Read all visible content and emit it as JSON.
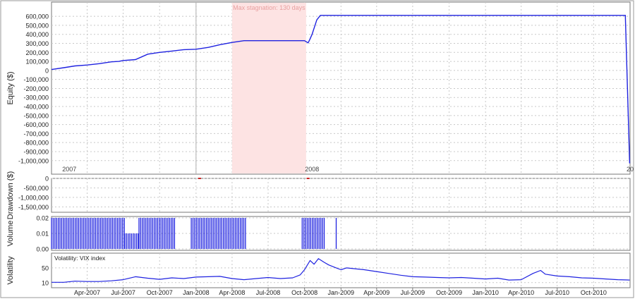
{
  "colors": {
    "series": "#1f22e0",
    "stagnation_fill": "#fde3e3",
    "stagnation_label": "#e8a0a0",
    "grid": "#c8c8c8",
    "axis": "#777777",
    "marker": "#cc2222"
  },
  "chart_data": [
    {
      "type": "line",
      "panel": "equity",
      "ylabel": "Equity ($)",
      "ylim": [
        -1080000,
        640000
      ],
      "yticks": [
        600000,
        500000,
        400000,
        300000,
        200000,
        100000,
        0,
        -100000,
        -200000,
        -300000,
        -400000,
        -500000,
        -600000,
        -700000,
        -800000,
        -900000,
        -1000000
      ],
      "ytick_labels": [
        "600,000",
        "500,000",
        "400,000",
        "300,000",
        "200,000",
        "100,000",
        "0",
        "-100,000",
        "-200,000",
        "-300,000",
        "-400,000",
        "-500,000",
        "-600,000",
        "-700,000",
        "-800,000",
        "-900,000",
        "-1,000,000"
      ],
      "year_labels": [
        {
          "x": "2007-02-15",
          "text": "2007"
        },
        {
          "x": "2008-10-20",
          "text": "2008"
        },
        {
          "x": "2011-01-01",
          "text": "20"
        }
      ],
      "annotation": {
        "text": "Max stagnation: 130 days",
        "start": "2008-04-01",
        "end": "2008-10-05"
      },
      "x": [
        "2007-01-01",
        "2007-02-01",
        "2007-03-01",
        "2007-04-01",
        "2007-05-01",
        "2007-06-01",
        "2007-06-20",
        "2007-07-01",
        "2007-08-01",
        "2007-09-01",
        "2007-10-01",
        "2007-11-01",
        "2007-12-01",
        "2008-01-01",
        "2008-02-01",
        "2008-03-01",
        "2008-04-01",
        "2008-05-01",
        "2008-07-01",
        "2008-09-01",
        "2008-10-01",
        "2008-10-10",
        "2008-10-14",
        "2008-10-20",
        "2008-11-01",
        "2008-11-10",
        "2008-12-01",
        "2009-06-01",
        "2010-01-01",
        "2010-07-01",
        "2010-12-20",
        "2010-12-31"
      ],
      "series": [
        {
          "values": [
            10000,
            30000,
            50000,
            60000,
            75000,
            95000,
            100000,
            110000,
            120000,
            180000,
            200000,
            215000,
            230000,
            235000,
            255000,
            285000,
            310000,
            330000,
            330000,
            330000,
            330000,
            305000,
            340000,
            400000,
            560000,
            610000,
            610000,
            610000,
            610000,
            610000,
            610000,
            -1030000
          ]
        }
      ]
    },
    {
      "type": "line",
      "panel": "drawdown",
      "ylabel": "Drawdown ($)",
      "ylim": [
        -1600000,
        0
      ],
      "yticks": [
        0,
        -500000,
        -1000000,
        -1500000
      ],
      "ytick_labels": [
        "0",
        "-500,000",
        "-1,000,000",
        "-1,500,000"
      ],
      "markers": [
        {
          "x": "2008-01-10",
          "y": 0
        },
        {
          "x": "2008-10-10",
          "y": 0
        }
      ]
    },
    {
      "type": "bar",
      "panel": "volume",
      "ylabel": "Volume",
      "ylim": [
        0,
        0.02
      ],
      "yticks": [
        0.02,
        0.01,
        0.0
      ],
      "ytick_labels": [
        "0.02",
        "0.01",
        "0.00"
      ],
      "bar_periods": [
        {
          "start": "2007-01-01",
          "end": "2007-07-05",
          "value": 0.02
        },
        {
          "start": "2007-07-05",
          "end": "2007-08-10",
          "value": 0.01
        },
        {
          "start": "2007-08-10",
          "end": "2007-11-10",
          "value": 0.02
        },
        {
          "start": "2007-12-20",
          "end": "2008-05-05",
          "value": 0.02
        },
        {
          "start": "2008-09-25",
          "end": "2008-11-20",
          "value": 0.02
        },
        {
          "start": "2008-12-20",
          "end": "2008-12-24",
          "value": 0.02
        }
      ]
    },
    {
      "type": "line",
      "panel": "volatility",
      "ylabel": "Volatility",
      "legend": "Volatility: VIX index",
      "ylim": [
        0,
        90
      ],
      "yticks": [
        50,
        10
      ],
      "ytick_labels": [
        "50",
        "10"
      ],
      "x_tick_labels": [
        {
          "x": "2007-04-01",
          "text": "Apr-2007"
        },
        {
          "x": "2007-07-01",
          "text": "Jul-2007"
        },
        {
          "x": "2007-10-01",
          "text": "Oct-2007"
        },
        {
          "x": "2008-01-01",
          "text": "Jan-2008"
        },
        {
          "x": "2008-04-01",
          "text": "Apr-2008"
        },
        {
          "x": "2008-07-01",
          "text": "Jul-2008"
        },
        {
          "x": "2008-10-01",
          "text": "Oct-2008"
        },
        {
          "x": "2009-01-01",
          "text": "Jan-2009"
        },
        {
          "x": "2009-04-01",
          "text": "Apr-2009"
        },
        {
          "x": "2009-07-01",
          "text": "Jul-2009"
        },
        {
          "x": "2009-10-01",
          "text": "Oct-2009"
        },
        {
          "x": "2010-01-01",
          "text": "Jan-2010"
        },
        {
          "x": "2010-04-01",
          "text": "Apr-2010"
        },
        {
          "x": "2010-07-01",
          "text": "Jul-2010"
        },
        {
          "x": "2010-10-01",
          "text": "Oct-2010"
        }
      ],
      "x": [
        "2007-01-01",
        "2007-02-01",
        "2007-03-01",
        "2007-04-01",
        "2007-05-01",
        "2007-06-01",
        "2007-07-01",
        "2007-08-01",
        "2007-09-01",
        "2007-10-01",
        "2007-11-01",
        "2007-12-01",
        "2008-01-01",
        "2008-02-01",
        "2008-03-01",
        "2008-04-01",
        "2008-05-01",
        "2008-06-01",
        "2008-07-01",
        "2008-08-01",
        "2008-09-01",
        "2008-09-20",
        "2008-10-01",
        "2008-10-15",
        "2008-10-25",
        "2008-11-05",
        "2008-11-20",
        "2008-12-01",
        "2008-12-15",
        "2009-01-01",
        "2009-01-15",
        "2009-02-01",
        "2009-03-01",
        "2009-04-01",
        "2009-05-01",
        "2009-06-01",
        "2009-07-01",
        "2009-08-01",
        "2009-09-01",
        "2009-10-01",
        "2009-11-01",
        "2009-12-01",
        "2010-01-01",
        "2010-02-01",
        "2010-03-01",
        "2010-04-01",
        "2010-05-01",
        "2010-05-20",
        "2010-06-01",
        "2010-07-01",
        "2010-08-01",
        "2010-09-01",
        "2010-10-01",
        "2010-11-01",
        "2010-12-01",
        "2010-12-31"
      ],
      "series": [
        {
          "values": [
            11,
            11,
            14,
            13,
            13,
            15,
            18,
            26,
            22,
            19,
            23,
            21,
            25,
            26,
            27,
            21,
            18,
            21,
            24,
            21,
            23,
            31,
            45,
            70,
            60,
            75,
            65,
            58,
            52,
            45,
            50,
            48,
            45,
            40,
            35,
            30,
            26,
            25,
            24,
            23,
            24,
            22,
            20,
            22,
            17,
            18,
            35,
            43,
            33,
            28,
            26,
            23,
            22,
            20,
            18,
            17
          ]
        }
      ]
    }
  ]
}
